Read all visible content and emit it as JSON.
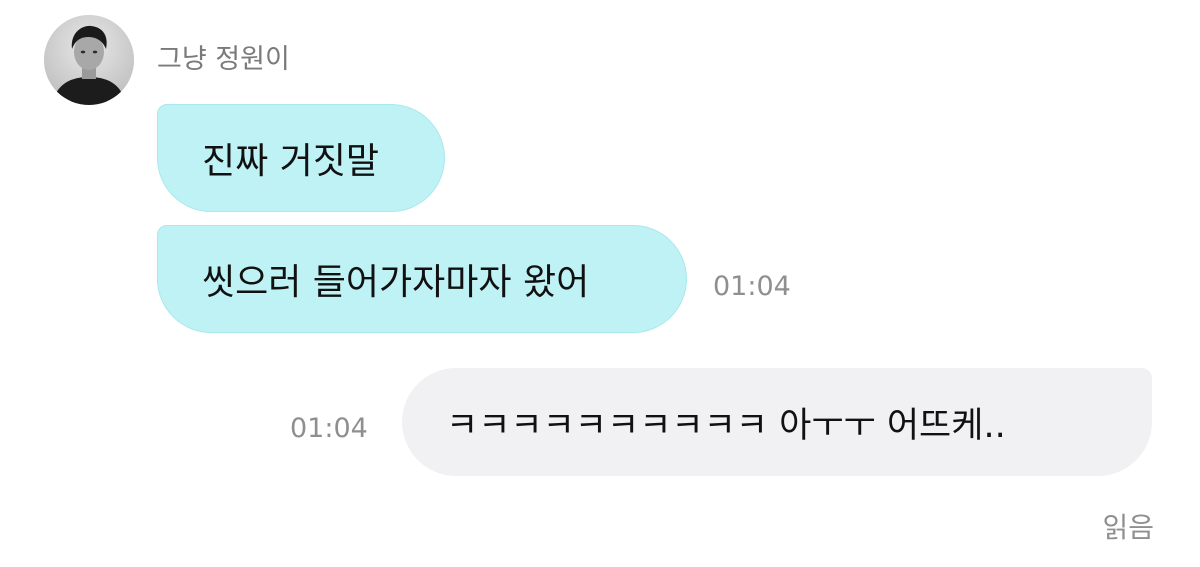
{
  "conversation": {
    "sender": {
      "name": "그냥 정원이",
      "avatar": "profile-photo"
    },
    "messages": [
      {
        "direction": "incoming",
        "text": "진짜 거짓말"
      },
      {
        "direction": "incoming",
        "text": "씻으러 들어가자마자 왔어",
        "time": "01:04"
      },
      {
        "direction": "outgoing",
        "text": "ㅋㅋㅋㅋㅋㅋㅋㅋㅋㅋ 아ㅜㅜ 어뜨케..",
        "time": "01:04"
      }
    ],
    "read_status": "읽음"
  },
  "colors": {
    "incoming_bubble": "#bff2f5",
    "outgoing_bubble": "#f1f1f3",
    "timestamp": "#8f8f8f",
    "sender_name": "#7a7a7a"
  }
}
